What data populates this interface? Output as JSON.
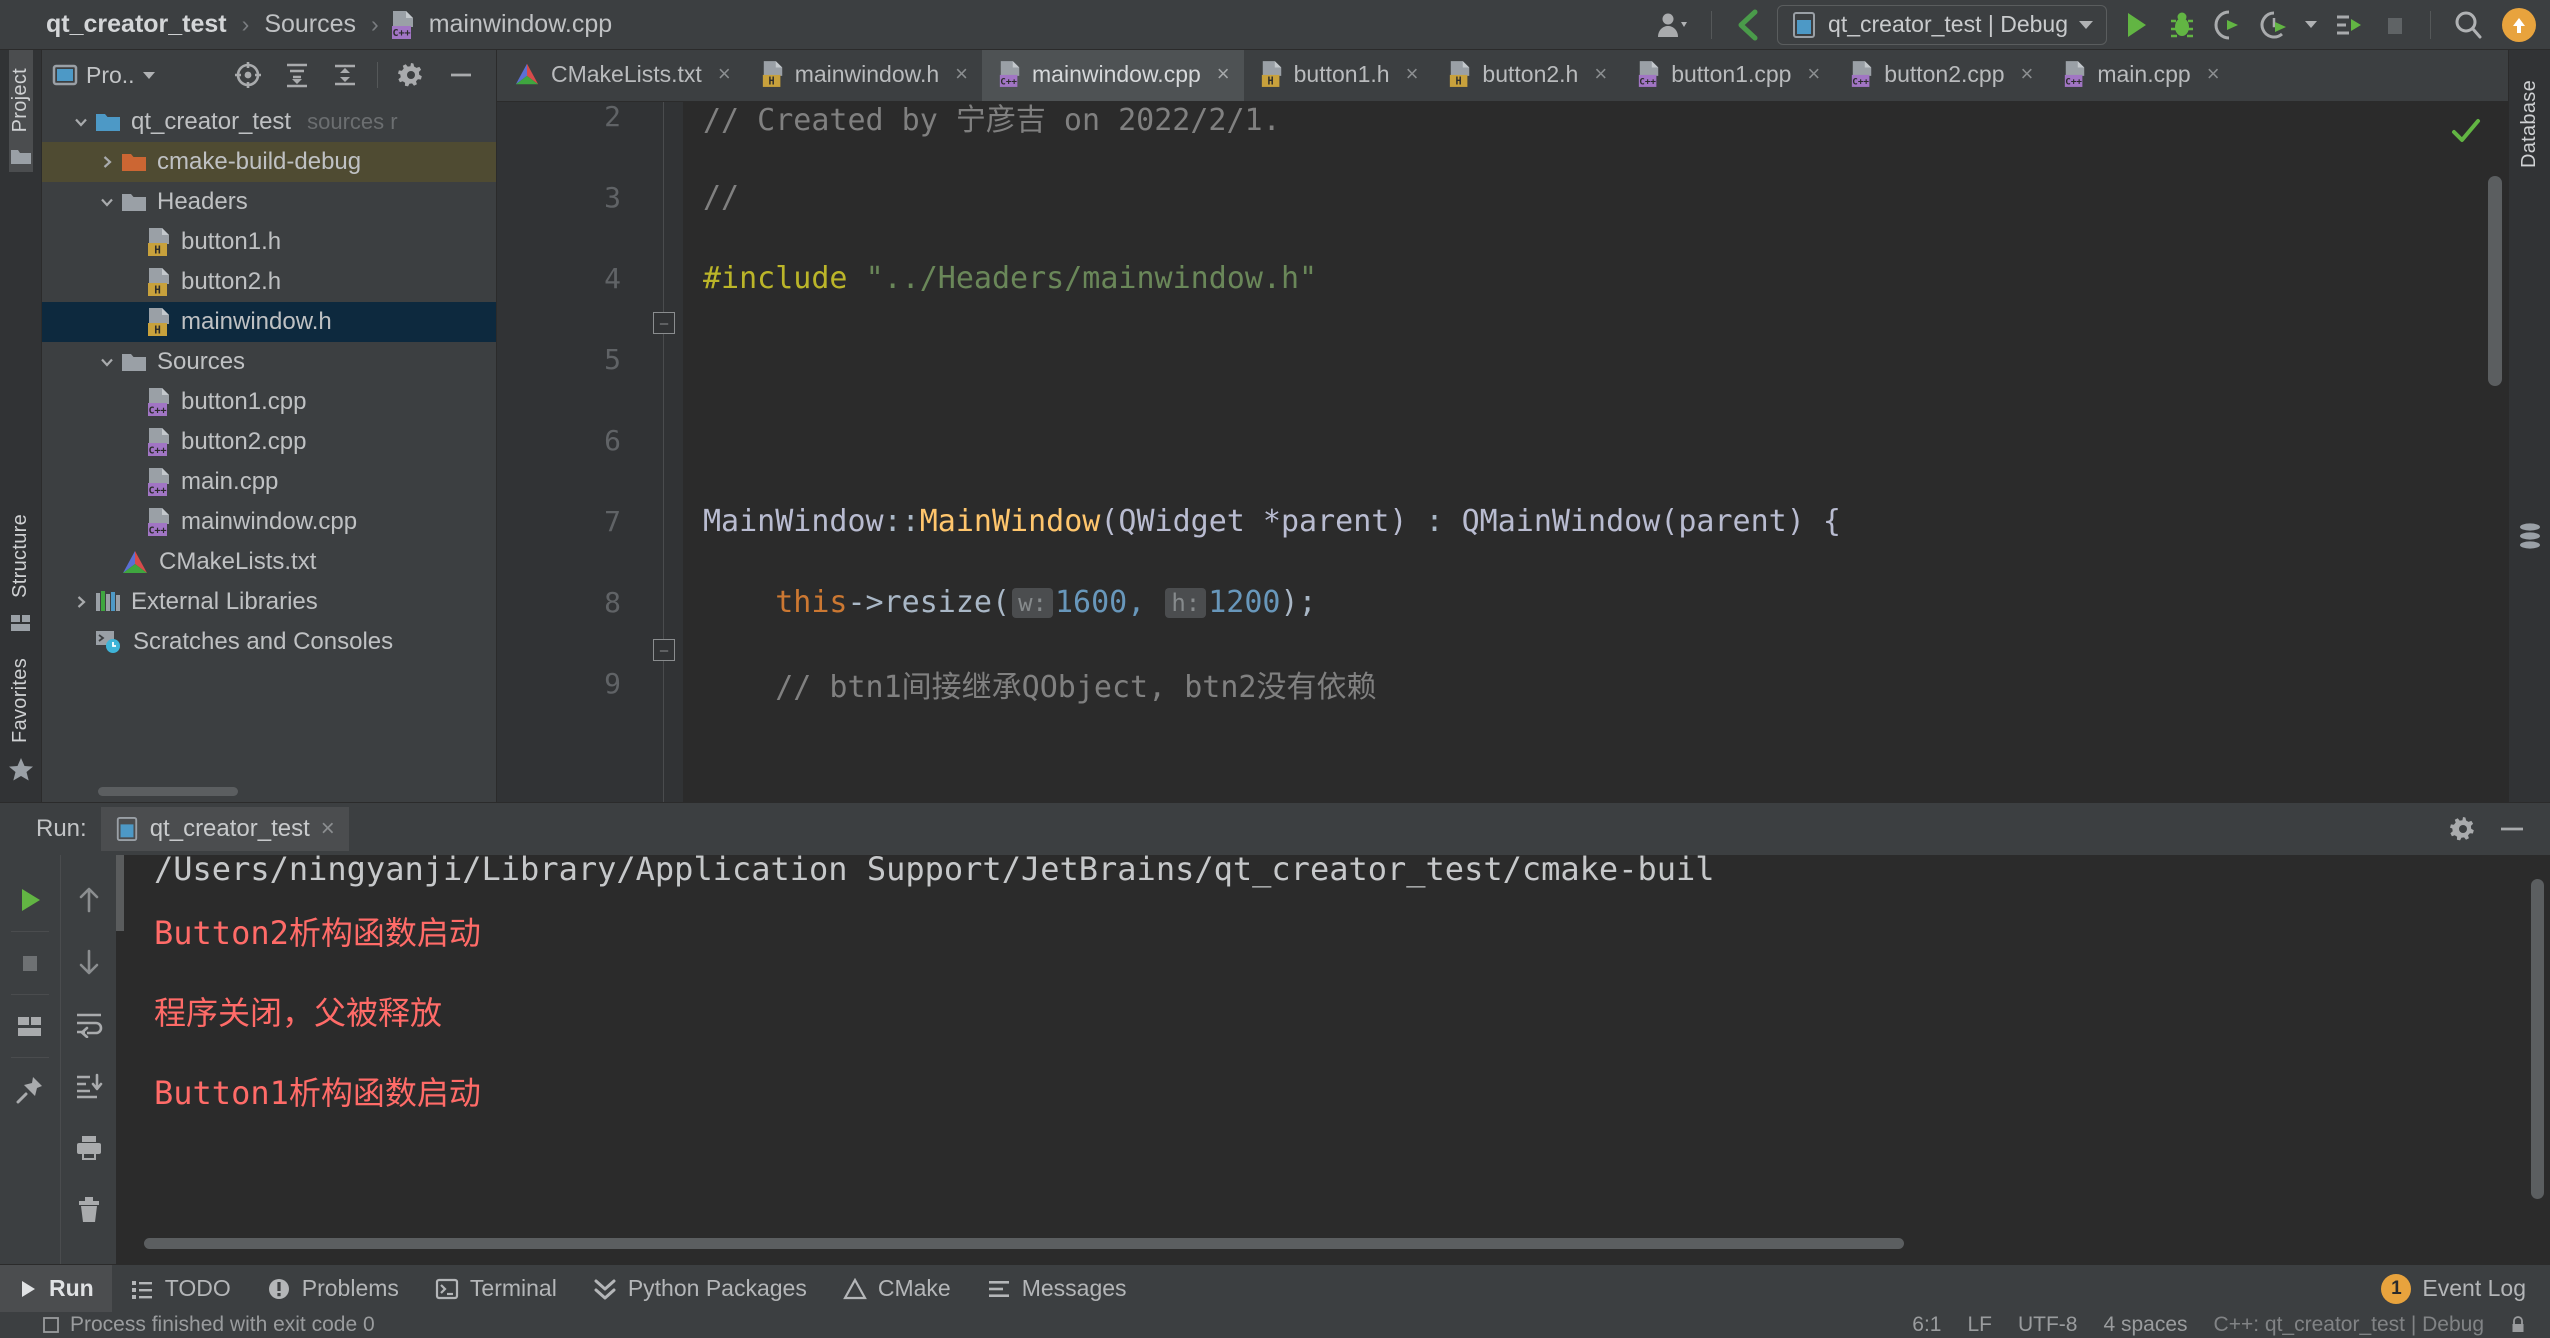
{
  "topbar": {
    "breadcrumb": [
      {
        "label": "qt_creator_test",
        "icon": "none",
        "bold": true
      },
      {
        "label": "Sources",
        "icon": "none",
        "bold": false
      },
      {
        "label": "mainwindow.cpp",
        "icon": "cpp-file-icon",
        "bold": false
      }
    ],
    "separator": "›",
    "account_icon": "user-account-icon",
    "vcs_icon": "vcs-branch-icon",
    "run_config": {
      "label": "qt_creator_test | Debug",
      "icon": "run-config-icon"
    },
    "actions": [
      {
        "name": "run-button",
        "icon": "play-icon",
        "color": "#62b543"
      },
      {
        "name": "debug-button",
        "icon": "bug-icon",
        "color": "#62b543"
      },
      {
        "name": "attach-profiler-button",
        "icon": "profiler-icon",
        "color": "#62b543"
      },
      {
        "name": "run-with-coverage-button",
        "icon": "coverage-icon",
        "color": "#62b543"
      },
      {
        "name": "more-run-button",
        "icon": "run-dashboard-icon",
        "color": "#62b543"
      },
      {
        "name": "stop-button",
        "icon": "stop-square-icon",
        "color": "#5f6365"
      },
      {
        "name": "search-everywhere-button",
        "icon": "search-icon",
        "color": "#b0b2b4"
      }
    ],
    "update_badge_icon": "update-arrow-icon",
    "update_badge_color": "#e8a33d"
  },
  "left_stripe": {
    "top": [
      {
        "label": "Project",
        "icon": "project-folder-icon",
        "active": true
      }
    ],
    "bottom": [
      {
        "label": "Structure",
        "icon": "structure-icon"
      },
      {
        "label": "Favorites",
        "icon": "star-icon"
      }
    ]
  },
  "right_stripe": {
    "items": [
      {
        "label": "Database",
        "icon": "database-icon"
      }
    ]
  },
  "project_panel": {
    "title": "Pro..",
    "title_icon": "project-view-icon",
    "buttons": [
      {
        "name": "select-opened-file-button",
        "icon": "locate-target-icon"
      },
      {
        "name": "expand-all-button",
        "icon": "expand-all-icon"
      },
      {
        "name": "collapse-all-button",
        "icon": "collapse-all-icon"
      },
      {
        "name": "settings-button",
        "icon": "gear-icon"
      },
      {
        "name": "hide-panel-button",
        "icon": "minimize-icon"
      }
    ],
    "tree": [
      {
        "label": "qt_creator_test",
        "suffix": "sources r",
        "icon": "folder-blue-icon",
        "arrow": "down",
        "indent": 0,
        "state": "none"
      },
      {
        "label": "cmake-build-debug",
        "suffix": "",
        "icon": "folder-orange-icon",
        "arrow": "right",
        "indent": 1,
        "state": "olive"
      },
      {
        "label": "Headers",
        "suffix": "",
        "icon": "folder-grey-icon",
        "arrow": "down",
        "indent": 1,
        "state": "none"
      },
      {
        "label": "button1.h",
        "suffix": "",
        "icon": "h-file-icon",
        "arrow": "none",
        "indent": 2,
        "state": "none"
      },
      {
        "label": "button2.h",
        "suffix": "",
        "icon": "h-file-icon",
        "arrow": "none",
        "indent": 2,
        "state": "none"
      },
      {
        "label": "mainwindow.h",
        "suffix": "",
        "icon": "h-file-icon",
        "arrow": "none",
        "indent": 2,
        "state": "blue"
      },
      {
        "label": "Sources",
        "suffix": "",
        "icon": "folder-grey-icon",
        "arrow": "down",
        "indent": 1,
        "state": "none"
      },
      {
        "label": "button1.cpp",
        "suffix": "",
        "icon": "cpp-file-icon",
        "arrow": "none",
        "indent": 2,
        "state": "none"
      },
      {
        "label": "button2.cpp",
        "suffix": "",
        "icon": "cpp-file-icon",
        "arrow": "none",
        "indent": 2,
        "state": "none"
      },
      {
        "label": "main.cpp",
        "suffix": "",
        "icon": "cpp-file-icon",
        "arrow": "none",
        "indent": 2,
        "state": "none"
      },
      {
        "label": "mainwindow.cpp",
        "suffix": "",
        "icon": "cpp-file-icon",
        "arrow": "none",
        "indent": 2,
        "state": "none"
      },
      {
        "label": "CMakeLists.txt",
        "suffix": "",
        "icon": "cmake-icon",
        "arrow": "none",
        "indent": 1,
        "state": "none"
      },
      {
        "label": "External Libraries",
        "suffix": "",
        "icon": "libraries-icon",
        "arrow": "right",
        "indent": 0,
        "state": "none"
      },
      {
        "label": "Scratches and Consoles",
        "suffix": "",
        "icon": "scratches-icon",
        "arrow": "none",
        "indent": 0,
        "state": "none"
      }
    ]
  },
  "editor_tabs": [
    {
      "label": "CMakeLists.txt",
      "icon": "cmake-icon",
      "active": false
    },
    {
      "label": "mainwindow.h",
      "icon": "h-file-icon",
      "active": false
    },
    {
      "label": "mainwindow.cpp",
      "icon": "cpp-file-icon",
      "active": true
    },
    {
      "label": "button1.h",
      "icon": "h-file-icon",
      "active": false
    },
    {
      "label": "button2.h",
      "icon": "h-file-icon",
      "active": false
    },
    {
      "label": "button1.cpp",
      "icon": "cpp-file-icon",
      "active": false
    },
    {
      "label": "button2.cpp",
      "icon": "cpp-file-icon",
      "active": false
    },
    {
      "label": "main.cpp",
      "icon": "cpp-file-icon",
      "active": false
    }
  ],
  "tab_close_glyph": "×",
  "editor": {
    "line_numbers": [
      "2",
      "3",
      "4",
      "5",
      "6",
      "7",
      "8",
      "9"
    ],
    "inspection_status_icon": "checkmark-icon",
    "code": {
      "l2_comment": "// Created by 宁彦吉 on 2022/2/1.",
      "l3_comment": "//",
      "l4_include": "#include",
      "l4_string": "\"../Headers/mainwindow.h\"",
      "l7_class": "MainWindow",
      "l7_scope": "::",
      "l7_ctor": "MainWindow",
      "l7_params": "(QWidget *parent)",
      "l7_colon": " : ",
      "l7_base": "QMainWindow(parent) {",
      "l8_this": "this",
      "l8_arrow": "->",
      "l8_call": "resize(",
      "l8_hint_w": "w:",
      "l8_val_w": "1600,",
      "l8_hint_h": "h:",
      "l8_val_h": "1200",
      "l8_tail": ");",
      "l9_comment": "// btn1间接继承QObject, btn2没有依赖"
    }
  },
  "run_panel": {
    "label": "Run:",
    "tab_label": "qt_creator_test",
    "tab_icon": "run-config-icon",
    "close_glyph": "×",
    "header_buttons": [
      {
        "name": "run-settings-button",
        "icon": "gear-icon"
      },
      {
        "name": "hide-run-panel-button",
        "icon": "minimize-icon"
      }
    ],
    "left_tools": [
      {
        "name": "rerun-button",
        "icon": "play-icon",
        "color": "#62b543"
      },
      {
        "name": "stop-process-button",
        "icon": "stop-square-icon",
        "color": "#6e7173"
      },
      {
        "name": "layout-settings-button",
        "icon": "layout-icon",
        "color": "#a9abad"
      },
      {
        "name": "pin-tab-button",
        "icon": "pin-icon",
        "color": "#a9abad"
      }
    ],
    "right_tools": [
      {
        "name": "previous-occurrence-button",
        "icon": "arrow-up-icon"
      },
      {
        "name": "next-occurrence-button",
        "icon": "arrow-down-icon"
      },
      {
        "name": "soft-wrap-button",
        "icon": "soft-wrap-icon"
      },
      {
        "name": "scroll-to-end-button",
        "icon": "scroll-to-end-icon"
      },
      {
        "name": "print-button",
        "icon": "printer-icon"
      },
      {
        "name": "clear-all-button",
        "icon": "trash-icon"
      }
    ],
    "console_lines": [
      {
        "text": "/Users/ningyanji/Library/Application Support/JetBrains/qt_creator_test/cmake-buil",
        "type": "path"
      },
      {
        "text": "Button2析构函数启动",
        "type": "error"
      },
      {
        "text": "程序关闭，父被释放",
        "type": "error"
      },
      {
        "text": "Button1析构函数启动",
        "type": "error"
      }
    ],
    "error_color": "#ff6b68"
  },
  "bottom_bar": {
    "items": [
      {
        "label": "Run",
        "icon": "play-icon",
        "active": true
      },
      {
        "label": "TODO",
        "icon": "todo-list-icon",
        "active": false
      },
      {
        "label": "Problems",
        "icon": "problems-icon",
        "active": false
      },
      {
        "label": "Terminal",
        "icon": "terminal-icon",
        "active": false
      },
      {
        "label": "Python Packages",
        "icon": "python-packages-icon",
        "active": false
      },
      {
        "label": "CMake",
        "icon": "cmake-icon",
        "active": false
      },
      {
        "label": "Messages",
        "icon": "messages-icon",
        "active": false
      }
    ],
    "event_log": {
      "label": "Event Log",
      "count": "1",
      "badge_color": "#e8a33d"
    }
  },
  "status_bar": {
    "message": "Process finished with exit code 0",
    "caret_position": "6:1",
    "line_separator": "LF",
    "encoding": "UTF-8",
    "indent": "4 spaces",
    "context": "C++: qt_creator_test | Debug",
    "lock_icon": "lock-icon"
  }
}
